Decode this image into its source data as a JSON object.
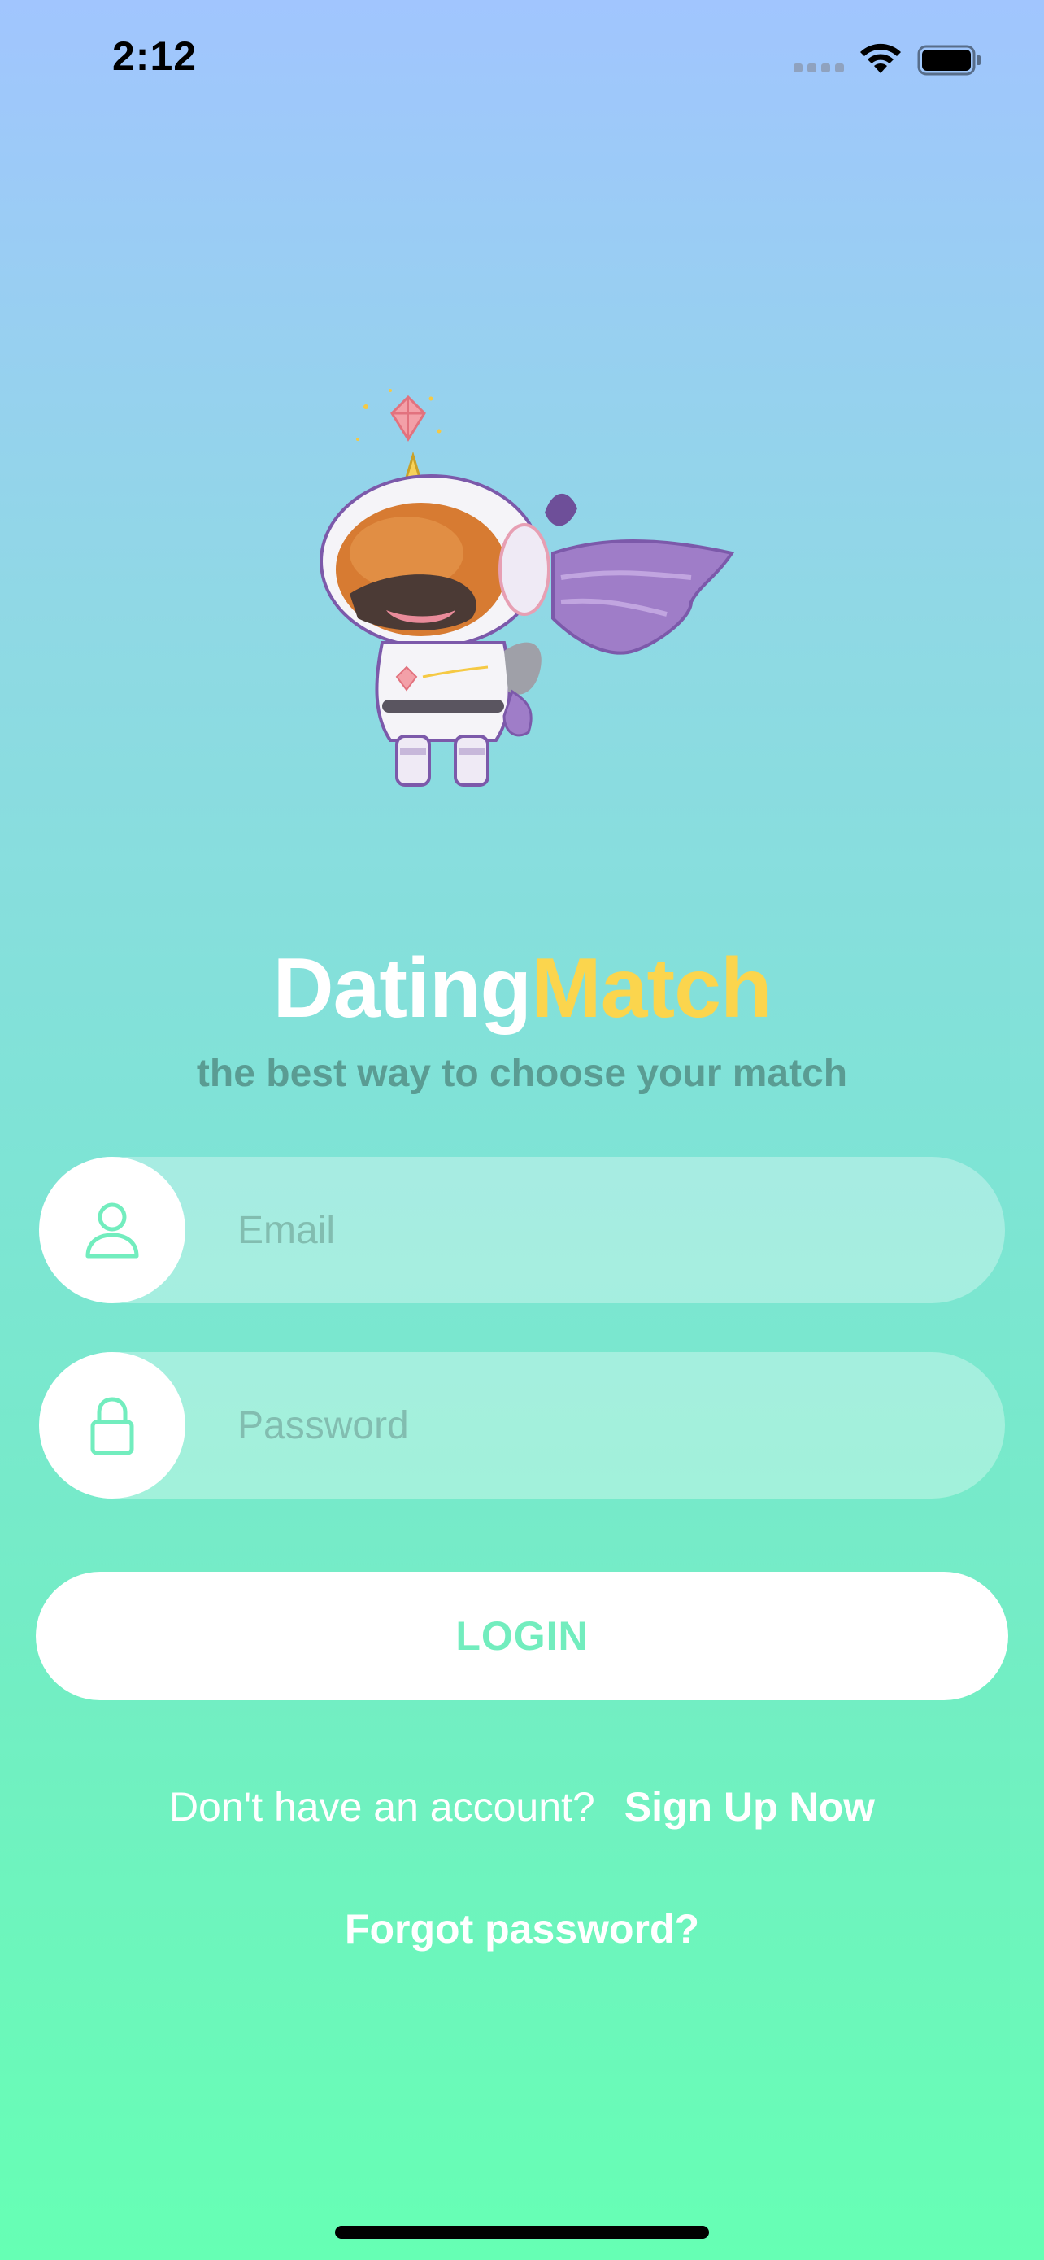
{
  "status_bar": {
    "time": "2:12",
    "icons": [
      "signal-icon",
      "wifi-icon",
      "battery-icon"
    ]
  },
  "mascot": {
    "icon": "astronaut-unicorn-mascot"
  },
  "brand": {
    "title_part_1": "Dating",
    "title_part_2": "Match",
    "tagline": "the best way to choose your match",
    "colors": {
      "title_primary": "#ffffff",
      "title_accent": "#fbd54d",
      "tagline": "#5a9c93"
    }
  },
  "form": {
    "email": {
      "placeholder": "Email",
      "value": "",
      "icon": "user-icon"
    },
    "password": {
      "placeholder": "Password",
      "value": "",
      "icon": "lock-icon"
    },
    "login_label": "LOGIN"
  },
  "signup": {
    "prompt": "Don't have an account?",
    "link": "Sign Up Now"
  },
  "forgot_password": "Forgot password?",
  "theme": {
    "gradient_top": "#a1c5fe",
    "gradient_bottom": "#66ffb4",
    "accent_green": "#72edbe"
  }
}
